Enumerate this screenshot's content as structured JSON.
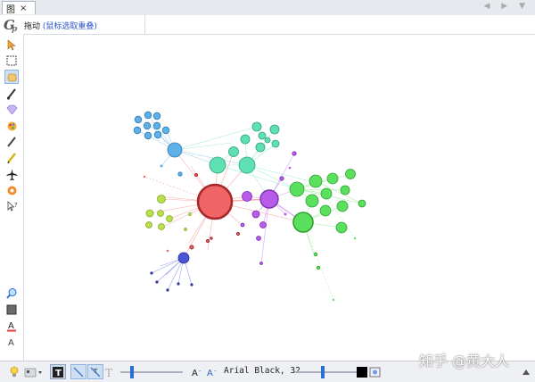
{
  "tab": {
    "title": "图",
    "close": "×"
  },
  "nav_arrows": "◀ ▶ ▼",
  "header": {
    "mode": "拖动",
    "hint": "(鼠标选取重叠)"
  },
  "toolbar": {
    "font_label": "Arial Black, 32"
  },
  "watermark": "知乎 @黄大人",
  "icons": {
    "left": [
      "cursor-icon",
      "rect-select-icon",
      "drag-hand-icon",
      "brush-icon",
      "diamond-icon",
      "painter-icon",
      "pencil-icon",
      "pencil-alt-icon",
      "airplane-icon",
      "gear-icon",
      "pointer-help-icon",
      "zoom-icon",
      "square-icon",
      "font-color-icon",
      "font-size-icon"
    ],
    "bottom": [
      "light-bulb-icon",
      "label-toggle-icon",
      "text-icon",
      "edge-icon",
      "edge-label-icon",
      "text-size-icon",
      "font-size-down-icon",
      "font-size-up-icon",
      "color-swatch-icon",
      "screenshot-icon"
    ]
  },
  "colors": {
    "red": "#f06466",
    "purple": "#b85be8",
    "green": "#5be05d",
    "teal": "#5fe0b2",
    "blue": "#5fb0e6",
    "lime": "#b7e04a",
    "darkblue": "#4b55d6"
  }
}
